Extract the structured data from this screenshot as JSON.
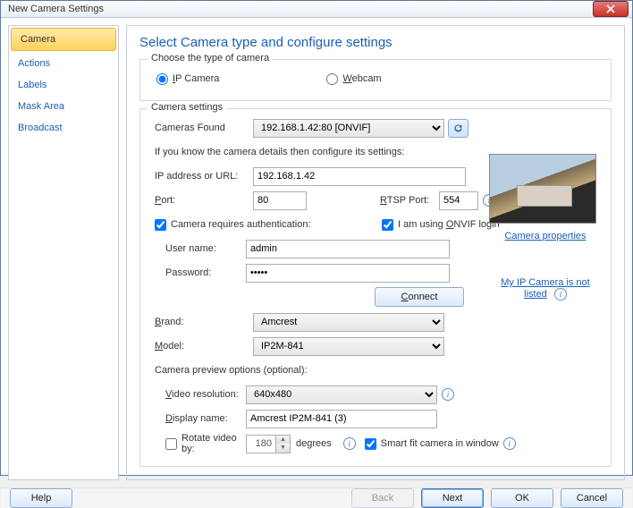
{
  "window": {
    "title": "New Camera Settings"
  },
  "sidebar": {
    "items": [
      {
        "label": "Camera",
        "selected": true
      },
      {
        "label": "Actions"
      },
      {
        "label": "Labels"
      },
      {
        "label": "Mask Area"
      },
      {
        "label": "Broadcast"
      }
    ]
  },
  "heading": "Select Camera type and configure settings",
  "typeGroup": {
    "legend": "Choose the type of camera",
    "ip": {
      "label": "IP Camera",
      "checked": true
    },
    "webcam": {
      "label": "Webcam",
      "checked": false
    }
  },
  "settings": {
    "legend": "Camera settings",
    "camerasFoundLabel": "Cameras Found",
    "camerasFoundValue": "192.168.1.42:80 [ONVIF]",
    "detailsHint": "If you know the camera details then configure its settings:",
    "ipLabel": "IP address or URL:",
    "ipValue": "192.168.1.42",
    "portLabel": "Port:",
    "portValue": "80",
    "rtspLabel": "RTSP Port:",
    "rtspValue": "554",
    "authLabel": "Camera requires authentication:",
    "authChecked": true,
    "onvifLabel": "I am using ONVIF login",
    "onvifChecked": true,
    "userLabel": "User name:",
    "userValue": "admin",
    "passLabel": "Password:",
    "passValue": "•••••",
    "connectLabel": "Connect",
    "brandLabel": "Brand:",
    "brandValue": "Amcrest",
    "modelLabel": "Model:",
    "modelValue": "IP2M-841",
    "previewLegend": "Camera preview options (optional):",
    "videoResLabel": "Video resolution:",
    "videoResValue": "640x480",
    "displayNameLabel": "Display name:",
    "displayNameValue": "Amcrest IP2M-841 (3)",
    "rotateLabel": "Rotate video by:",
    "rotateValue": "180",
    "rotateUnit": "degrees",
    "rotateChecked": false,
    "smartFitLabel": "Smart fit camera in window",
    "smartFitChecked": true
  },
  "links": {
    "cameraProps": "Camera properties",
    "notListed": "My IP Camera is not listed"
  },
  "footer": {
    "help": "Help",
    "back": "Back",
    "next": "Next",
    "ok": "OK",
    "cancel": "Cancel"
  }
}
